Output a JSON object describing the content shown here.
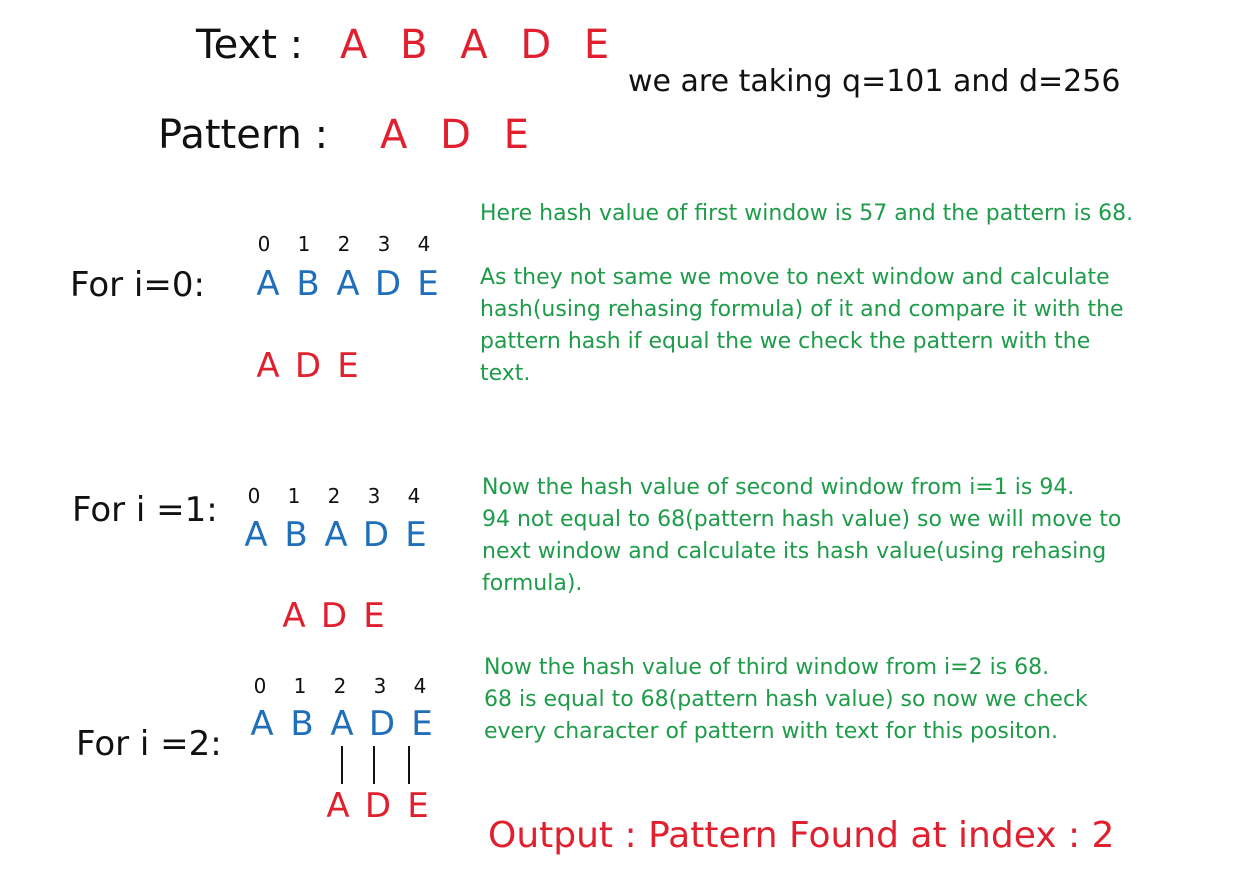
{
  "header": {
    "text_label": "Text :",
    "text_value": "A B A D E",
    "pattern_label": "Pattern  :",
    "pattern_value": "A D E",
    "params_note": "we are taking q=101 and d=256"
  },
  "steps": [
    {
      "label": "For i=0:",
      "indices": [
        "0",
        "1",
        "2",
        "3",
        "4"
      ],
      "text_chars": [
        "A",
        "B",
        "A",
        "D",
        "E"
      ],
      "pattern_chars": [
        "A",
        "D",
        "E"
      ],
      "explanation": [
        "Here hash value of first window is 57 and the pattern is 68.",
        "As they not same we move to next window and calculate hash(using rehasing formula) of it and compare it with the pattern hash if equal the we check the pattern with the text."
      ]
    },
    {
      "label": "For i =1:",
      "indices": [
        "0",
        "1",
        "2",
        "3",
        "4"
      ],
      "text_chars": [
        "A",
        "B",
        "A",
        "D",
        "E"
      ],
      "pattern_chars": [
        "A",
        "D",
        "E"
      ],
      "explanation": [
        "Now the hash value of second window from i=1 is 94.",
        "94 not equal to 68(pattern hash value) so we will move to next window and calculate its hash value(using rehasing formula)."
      ]
    },
    {
      "label": "For i =2:",
      "indices": [
        "0",
        "1",
        "2",
        "3",
        "4"
      ],
      "text_chars": [
        "A",
        "B",
        "A",
        "D",
        "E"
      ],
      "pattern_chars": [
        "A",
        "D",
        "E"
      ],
      "explanation": [
        "Now the hash value of third window from i=2 is 68.",
        "68 is equal to 68(pattern hash value) so now we check every character of pattern with text for this positon."
      ]
    }
  ],
  "output": "Output : Pattern Found at index : 2",
  "colors": {
    "text": "#111111",
    "highlight_red": "#e0202f",
    "text_blue": "#1f6fba",
    "explain_green": "#1e9c4a"
  }
}
